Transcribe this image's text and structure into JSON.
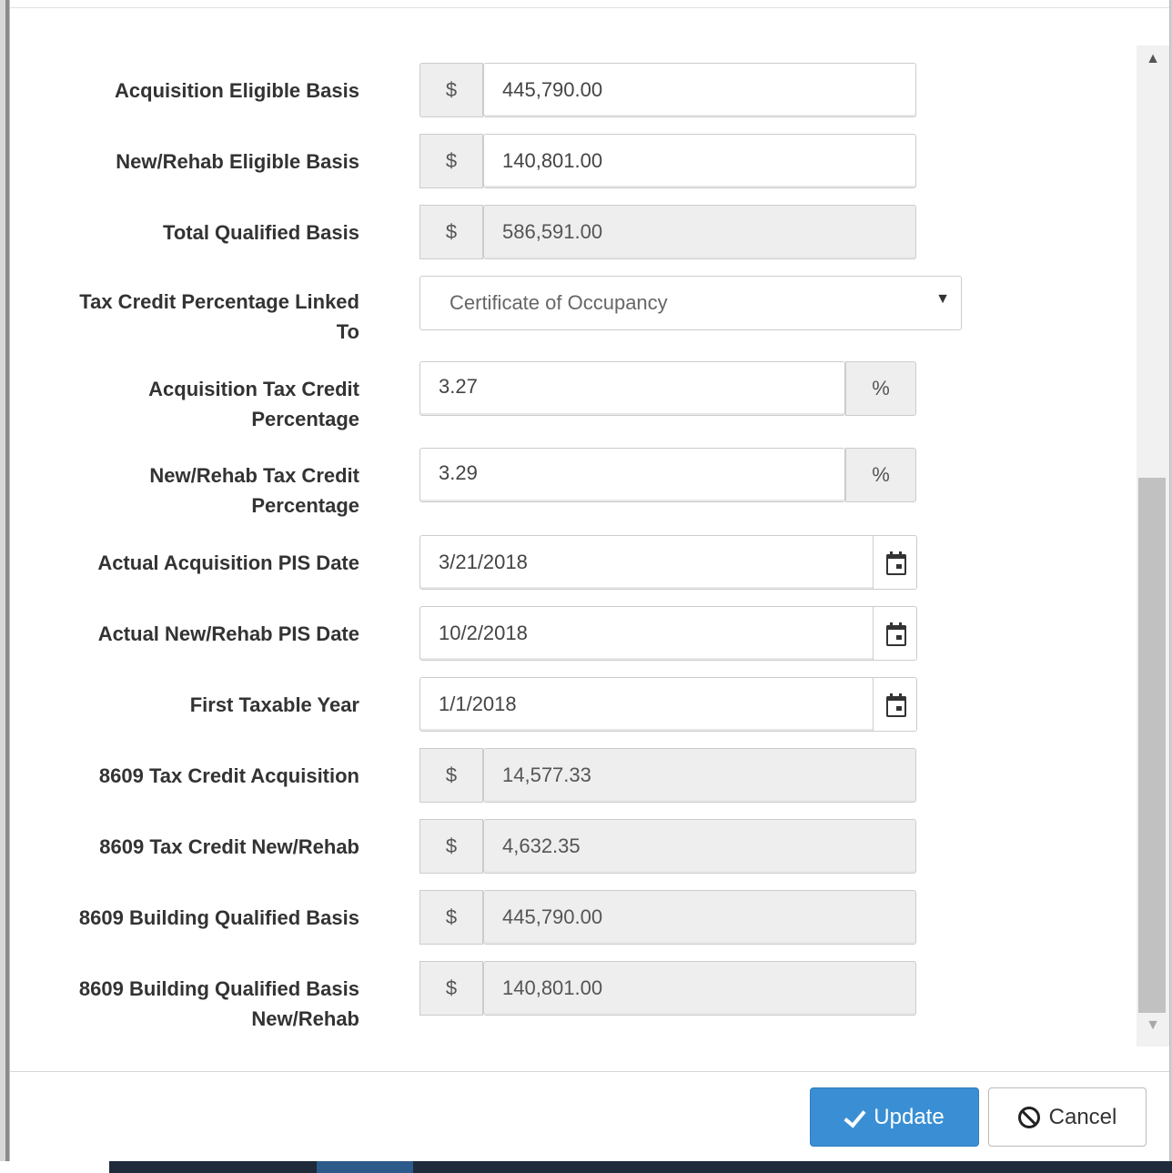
{
  "form": {
    "acquisition_eligible_basis": {
      "label": "Acquisition Eligible Basis",
      "addon": "$",
      "value": "445,790.00"
    },
    "new_rehab_eligible_basis": {
      "label": "New/Rehab Eligible Basis",
      "addon": "$",
      "value": "140,801.00"
    },
    "total_qualified_basis": {
      "label": "Total Qualified Basis",
      "addon": "$",
      "value": "586,591.00"
    },
    "tax_credit_linked_to": {
      "label_line1": "Tax Credit Percentage Linked",
      "label_line2": "To",
      "selected": "Certificate of Occupancy",
      "caret": "▼"
    },
    "acquisition_tax_credit_pct": {
      "label_line1": "Acquisition Tax Credit",
      "label_line2": "Percentage",
      "value": "3.27",
      "addon": "%"
    },
    "new_rehab_tax_credit_pct": {
      "label_line1": "New/Rehab Tax Credit",
      "label_line2": "Percentage",
      "value": "3.29",
      "addon": "%"
    },
    "actual_acquisition_pis_date": {
      "label": "Actual Acquisition PIS Date",
      "value": "3/21/2018"
    },
    "actual_new_rehab_pis_date": {
      "label": "Actual New/Rehab PIS Date",
      "value": "10/2/2018"
    },
    "first_taxable_year": {
      "label": "First Taxable Year",
      "value": "1/1/2018"
    },
    "tax_credit_acquisition_8609": {
      "label": "8609 Tax Credit Acquisition",
      "addon": "$",
      "value": "14,577.33"
    },
    "tax_credit_new_rehab_8609": {
      "label": "8609 Tax Credit New/Rehab",
      "addon": "$",
      "value": "4,632.35"
    },
    "building_qualified_basis_8609": {
      "label": "8609 Building Qualified Basis",
      "addon": "$",
      "value": "445,790.00"
    },
    "building_qualified_basis_new_rehab_8609": {
      "label_line1": "8609 Building Qualified Basis",
      "label_line2": "New/Rehab",
      "addon": "$",
      "value": "140,801.00"
    }
  },
  "footer": {
    "update_label": "Update",
    "cancel_label": "Cancel"
  },
  "icons": {
    "calendar": "calendar-icon",
    "check": "check-icon",
    "cancel": "ban-icon"
  },
  "colors": {
    "primary": "#3a8fd4",
    "readonly_bg": "#eeeeee",
    "addon_bg": "#eeeeee"
  }
}
